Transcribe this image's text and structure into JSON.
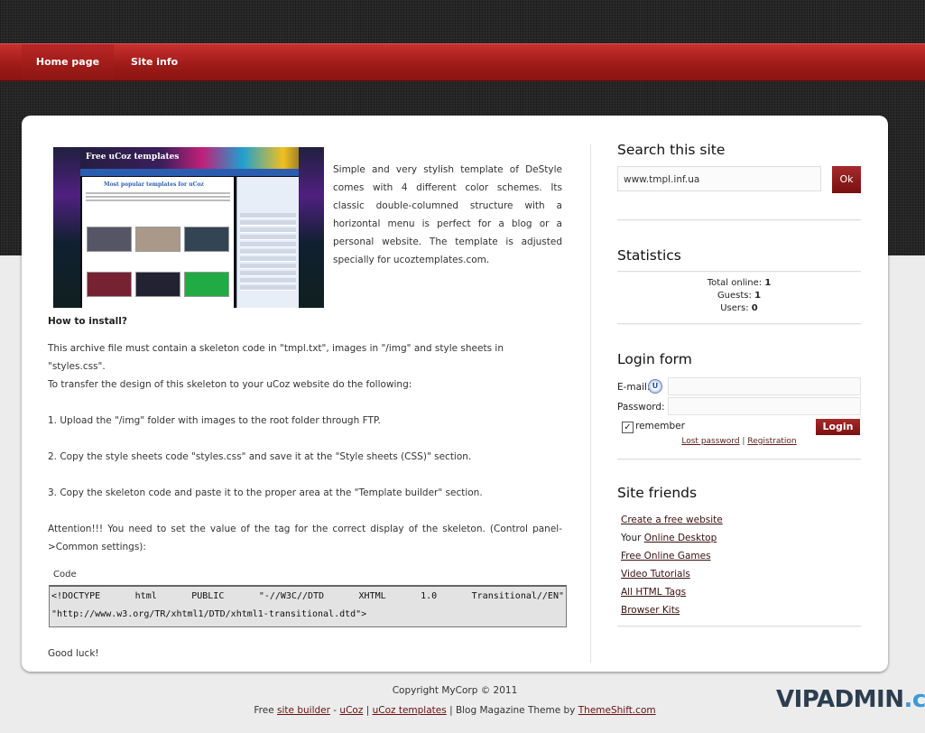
{
  "nav": {
    "home": "Home page",
    "info": "Site info"
  },
  "content": {
    "thumb": {
      "title": "Free uCoz templates",
      "heading": "Most popular templates for uCoz"
    },
    "intro": "Simple and very stylish template of DeStyle comes with 4 different color schemes. Its classic double-columned structure with a horizontal menu is perfect for a blog or a personal website. The template is adjusted specially for ucoztemplates.com.",
    "how_title": "How to install?",
    "paragraphs": [
      "This archive file must contain a skeleton code in \"tmpl.txt\", images in \"/img\" and style sheets in \"styles.css\".",
      "To transfer the design of this skeleton to your uCoz website do the following:",
      "1. Upload the \"/img\" folder with images to the root folder through FTP.",
      "2. Copy the style sheets code \"styles.css\" and save it at the \"Style sheets (CSS)\" section.",
      "3. Copy the skeleton code and paste it to the proper area at the \"Template builder\" section.",
      "Attention!!! You need to set the value of the tag for the correct display of the skeleton. (Control panel->Common settings):"
    ],
    "code_label": "Code",
    "code_tokens": [
      "<!DOCTYPE",
      "html",
      "PUBLIC",
      "\"-//W3C//DTD",
      "XHTML",
      "1.0",
      "Transitional//EN\""
    ],
    "code_line2": "\"http://www.w3.org/TR/xhtml1/DTD/xhtml1-transitional.dtd\">",
    "good_luck": "Good luck!"
  },
  "sidebar": {
    "search": {
      "title": "Search this site",
      "value": "www.tmpl.inf.ua",
      "button": "Ok"
    },
    "stats": {
      "title": "Statistics",
      "total_label": "Total online:",
      "total": "1",
      "guests_label": "Guests:",
      "guests": "1",
      "users_label": "Users:",
      "users": "0"
    },
    "login": {
      "title": "Login form",
      "email_label": "E-mail:",
      "password_label": "Password:",
      "u_icon": "U",
      "remember_label": "remember",
      "button": "Login",
      "lost_password": "Lost password",
      "separator": "|",
      "registration": "Registration"
    },
    "friends": {
      "title": "Site friends",
      "item1": "Create a free website",
      "item2_prefix": "Your",
      "item2_link": "Online Desktop",
      "item3": "Free Online Games",
      "item4": "Video Tutorials",
      "item5": "All HTML Tags",
      "item6": "Browser Kits"
    }
  },
  "footer": {
    "copyright": "Copyright MyCorp © 2011",
    "free": "Free",
    "site_builder": "site builder",
    "dash": "-",
    "ucoz": "uCoz",
    "sep": "|",
    "ucoz_templates": "uCoz templates",
    "blog_text": "| Blog Magazine Theme by",
    "themeshift": "ThemeShift.com"
  },
  "watermark": {
    "part1": "VIPADMIN",
    "part2": ".club"
  }
}
